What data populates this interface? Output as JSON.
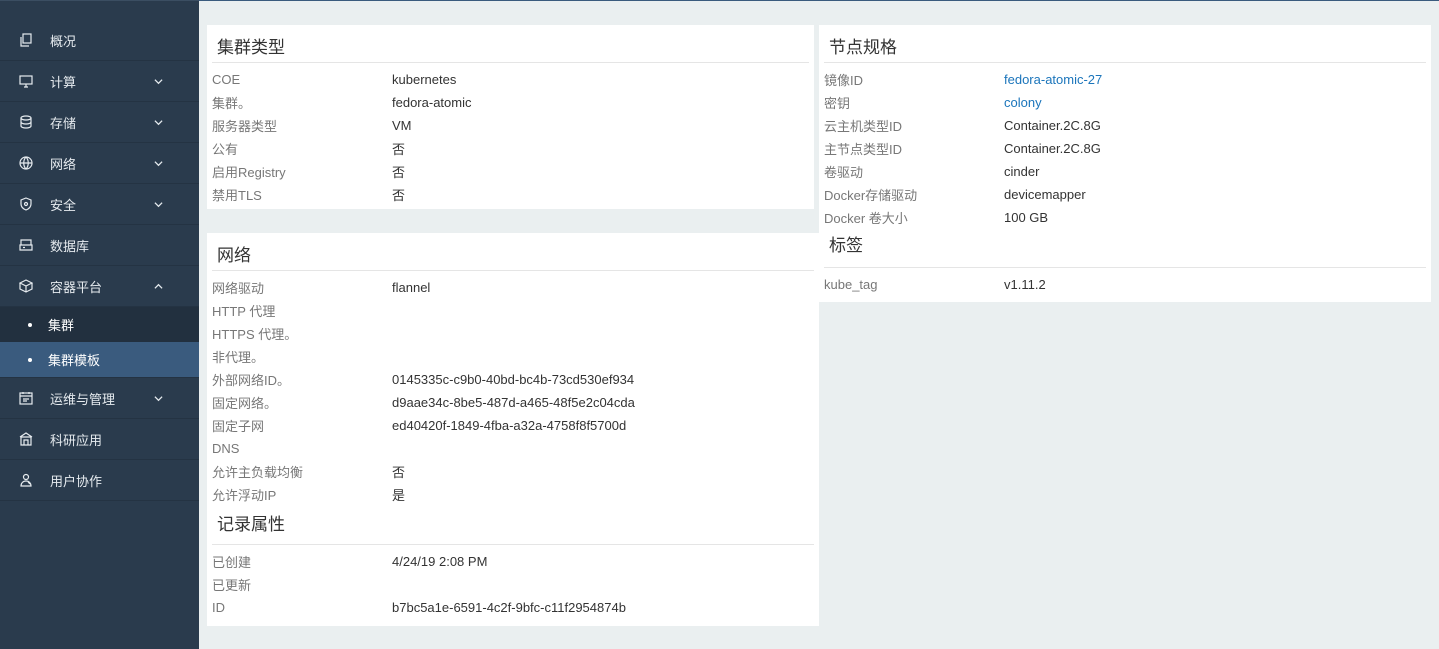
{
  "sidebar": {
    "items": [
      {
        "label": "概况",
        "icon": "copy-icon",
        "expandable": false
      },
      {
        "label": "计算",
        "icon": "monitor-icon",
        "expandable": true
      },
      {
        "label": "存储",
        "icon": "database-icon",
        "expandable": true
      },
      {
        "label": "网络",
        "icon": "network-icon",
        "expandable": true
      },
      {
        "label": "安全",
        "icon": "shield-icon",
        "expandable": true
      },
      {
        "label": "数据库",
        "icon": "db-box-icon",
        "expandable": false
      },
      {
        "label": "容器平台",
        "icon": "cube-icon",
        "expandable": true,
        "expanded": true
      },
      {
        "label": "运维与管理",
        "icon": "calendar-icon",
        "expandable": true
      },
      {
        "label": "科研应用",
        "icon": "building-icon",
        "expandable": false
      },
      {
        "label": "用户协作",
        "icon": "users-icon",
        "expandable": false
      }
    ],
    "container_sub": [
      {
        "label": "集群",
        "active": false
      },
      {
        "label": "集群模板",
        "active": true
      }
    ]
  },
  "cluster_type": {
    "title": "集群类型",
    "rows": [
      {
        "k": "COE",
        "v": "kubernetes"
      },
      {
        "k": "集群。",
        "v": "fedora-atomic"
      },
      {
        "k": "服务器类型",
        "v": "VM"
      },
      {
        "k": "公有",
        "v": "否"
      },
      {
        "k": "启用Registry",
        "v": "否"
      },
      {
        "k": "禁用TLS",
        "v": "否"
      }
    ]
  },
  "network": {
    "title": "网络",
    "rows": [
      {
        "k": "网络驱动",
        "v": "flannel"
      },
      {
        "k": "HTTP 代理",
        "v": ""
      },
      {
        "k": "HTTPS 代理。",
        "v": ""
      },
      {
        "k": "非代理。",
        "v": ""
      },
      {
        "k": "外部网络ID。",
        "v": "0145335c-c9b0-40bd-bc4b-73cd530ef934"
      },
      {
        "k": "固定网络。",
        "v": "d9aae34c-8be5-487d-a465-48f5e2c04cda"
      },
      {
        "k": "固定子网",
        "v": "ed40420f-1849-4fba-a32a-4758f8f5700d"
      },
      {
        "k": "DNS",
        "v": ""
      },
      {
        "k": "允许主负载均衡",
        "v": "否"
      },
      {
        "k": "允许浮动IP",
        "v": "是"
      }
    ]
  },
  "record": {
    "title": "记录属性",
    "rows": [
      {
        "k": "已创建",
        "v": "4/24/19 2:08 PM"
      },
      {
        "k": "已更新",
        "v": ""
      },
      {
        "k": "ID",
        "v": "b7bc5a1e-6591-4c2f-9bfc-c11f2954874b"
      }
    ]
  },
  "node_spec": {
    "title": "节点规格",
    "rows": [
      {
        "k": "镜像ID",
        "v": "fedora-atomic-27",
        "link": true
      },
      {
        "k": "密钥",
        "v": "colony",
        "link": true
      },
      {
        "k": "云主机类型ID",
        "v": "Container.2C.8G"
      },
      {
        "k": "主节点类型ID",
        "v": "Container.2C.8G"
      },
      {
        "k": "卷驱动",
        "v": "cinder"
      },
      {
        "k": "Docker存储驱动",
        "v": "devicemapper"
      },
      {
        "k": "Docker 卷大小",
        "v": "100 GB"
      }
    ]
  },
  "labels": {
    "title": "标签",
    "rows": [
      {
        "k": "kube_tag",
        "v": "v1.11.2"
      }
    ]
  },
  "colors": {
    "sidebar_bg": "#2a3b4d",
    "active_sub_bg": "#3a5b7e",
    "link": "#1b75bb",
    "page_bg": "#eaeff0"
  }
}
